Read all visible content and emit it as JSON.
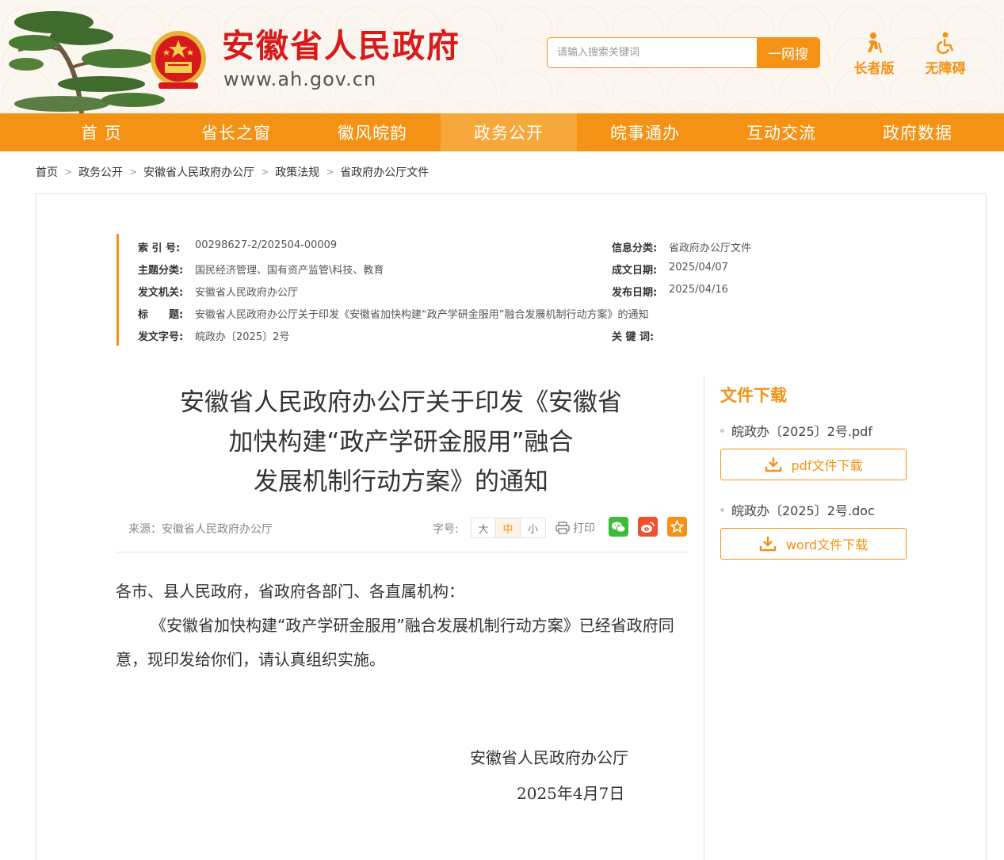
{
  "header": {
    "site_title": "安徽省人民政府",
    "site_url": "www.ah.gov.cn",
    "search_placeholder": "请输入搜索关键词",
    "search_button": "一网搜",
    "elder_mode": "长者版",
    "accessibility": "无障碍"
  },
  "nav": {
    "items": [
      "首 页",
      "省长之窗",
      "徽风皖韵",
      "政务公开",
      "皖事通办",
      "互动交流",
      "政府数据"
    ],
    "active_index": 3
  },
  "breadcrumb": [
    "首页",
    "政务公开",
    "安徽省人民政府办公厅",
    "政策法规",
    "省政府办公厅文件"
  ],
  "meta": {
    "index_no_label": "索 引 号:",
    "index_no": "00298627-2/202504-00009",
    "category_label": "信息分类:",
    "category": "省政府办公厅文件",
    "topic_label": "主题分类:",
    "topic": "国民经济管理、国有资产监管\\科技、教育",
    "written_date_label": "成文日期:",
    "written_date": "2025/04/07",
    "issuer_label": "发文机关:",
    "issuer": "安徽省人民政府办公厅",
    "publish_date_label": "发布日期:",
    "publish_date": "2025/04/16",
    "title_label": "标　　题:",
    "title": "安徽省人民政府办公厅关于印发《安徽省加快构建“政产学研金服用”融合发展机制行动方案》的通知",
    "doc_no_label": "发文字号:",
    "doc_no": "皖政办〔2025〕2号",
    "keywords_label": "关 键 词:",
    "keywords": ""
  },
  "document": {
    "title_line1": "安徽省人民政府办公厅关于印发《安徽省",
    "title_line2": "加快构建“政产学研金服用”融合",
    "title_line3": "发展机制行动方案》的通知",
    "source": "来源：安徽省人民政府办公厅",
    "font_size_label": "字号:",
    "font_sizes": [
      "大",
      "中",
      "小"
    ],
    "font_size_active": 1,
    "print_label": "打印",
    "salutation": "各市、县人民政府，省政府各部门、各直属机构：",
    "paragraph1": "《安徽省加快构建“政产学研金服用”融合发展机制行动方案》已经省政府同意，现印发给你们，请认真组织实施。",
    "signer": "安徽省人民政府办公厅",
    "sign_date": "2025年4月7日"
  },
  "downloads": {
    "title": "文件下载",
    "files": [
      {
        "name": "皖政办〔2025〕2号.pdf",
        "button": "pdf文件下载"
      },
      {
        "name": "皖政办〔2025〕2号.doc",
        "button": "word文件下载"
      }
    ]
  },
  "colors": {
    "brand_orange": "#f39214",
    "title_red": "#d71a1a"
  }
}
